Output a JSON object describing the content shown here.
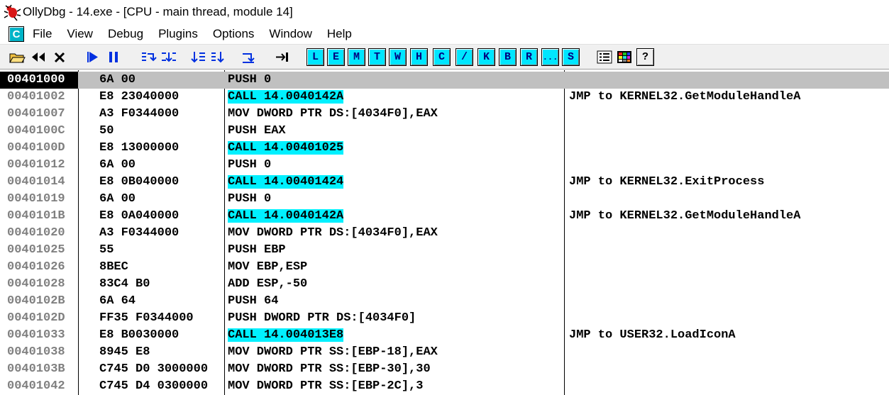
{
  "window": {
    "title": "OllyDbg - 14.exe - [CPU - main thread, module 14]",
    "icon": "ollydbg-bug-icon"
  },
  "menu": {
    "c_button": "C",
    "items": [
      "File",
      "View",
      "Debug",
      "Plugins",
      "Options",
      "Window",
      "Help"
    ]
  },
  "toolbar": {
    "letters": [
      "L",
      "E",
      "M",
      "T",
      "W",
      "H",
      "C",
      "/",
      "K",
      "B",
      "R",
      "...",
      "S"
    ],
    "help": "?"
  },
  "disasm": {
    "rows": [
      {
        "addr": "00401000",
        "hex": "6A 00",
        "dis": "PUSH 0",
        "comment": "",
        "call": false
      },
      {
        "addr": "00401002",
        "hex": "E8 23040000",
        "dis": "CALL 14.0040142A",
        "comment": "JMP to KERNEL32.GetModuleHandleA",
        "call": true
      },
      {
        "addr": "00401007",
        "hex": "A3 F0344000",
        "dis": "MOV DWORD PTR DS:[4034F0],EAX",
        "comment": "",
        "call": false
      },
      {
        "addr": "0040100C",
        "hex": "50",
        "dis": "PUSH EAX",
        "comment": "",
        "call": false
      },
      {
        "addr": "0040100D",
        "hex": "E8 13000000",
        "dis": "CALL 14.00401025",
        "comment": "",
        "call": true
      },
      {
        "addr": "00401012",
        "hex": "6A 00",
        "dis": "PUSH 0",
        "comment": "",
        "call": false
      },
      {
        "addr": "00401014",
        "hex": "E8 0B040000",
        "dis": "CALL 14.00401424",
        "comment": "JMP to KERNEL32.ExitProcess",
        "call": true
      },
      {
        "addr": "00401019",
        "hex": "6A 00",
        "dis": "PUSH 0",
        "comment": "",
        "call": false
      },
      {
        "addr": "0040101B",
        "hex": "E8 0A040000",
        "dis": "CALL 14.0040142A",
        "comment": "JMP to KERNEL32.GetModuleHandleA",
        "call": true
      },
      {
        "addr": "00401020",
        "hex": "A3 F0344000",
        "dis": "MOV DWORD PTR DS:[4034F0],EAX",
        "comment": "",
        "call": false
      },
      {
        "addr": "00401025",
        "hex": "55",
        "dis": "PUSH EBP",
        "comment": "",
        "call": false
      },
      {
        "addr": "00401026",
        "hex": "8BEC",
        "dis": "MOV EBP,ESP",
        "comment": "",
        "call": false
      },
      {
        "addr": "00401028",
        "hex": "83C4 B0",
        "dis": "ADD ESP,-50",
        "comment": "",
        "call": false
      },
      {
        "addr": "0040102B",
        "hex": "6A 64",
        "dis": "PUSH 64",
        "comment": "",
        "call": false
      },
      {
        "addr": "0040102D",
        "hex": "FF35 F0344000",
        "dis": "PUSH DWORD PTR DS:[4034F0]",
        "comment": "",
        "call": false
      },
      {
        "addr": "00401033",
        "hex": "E8 B0030000",
        "dis": "CALL 14.004013E8",
        "comment": "JMP to USER32.LoadIconA",
        "call": true
      },
      {
        "addr": "00401038",
        "hex": "8945 E8",
        "dis": "MOV DWORD PTR SS:[EBP-18],EAX",
        "comment": "",
        "call": false
      },
      {
        "addr": "0040103B",
        "hex": "C745 D0 3000000",
        "dis": "MOV DWORD PTR SS:[EBP-30],30",
        "comment": "",
        "call": false
      },
      {
        "addr": "00401042",
        "hex": "C745 D4 0300000",
        "dis": "MOV DWORD PTR SS:[EBP-2C],3",
        "comment": "",
        "call": false
      }
    ]
  },
  "colors": {
    "call_highlight": "#00f0ff",
    "selected_addr_bg": "#000000",
    "selected_row_bg": "#c0c0c0",
    "toolbar_letter_bg": "#00e6ff"
  }
}
